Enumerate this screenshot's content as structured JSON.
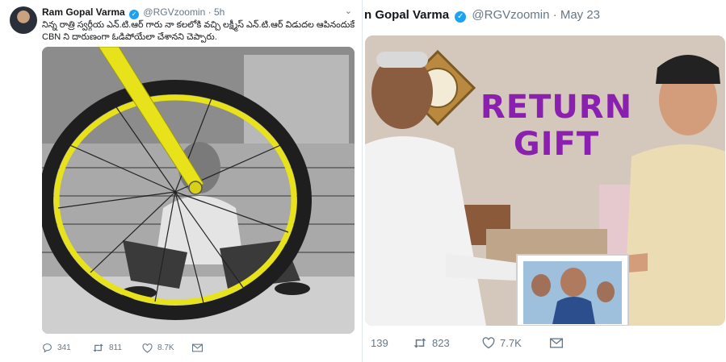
{
  "left_tweet": {
    "display_name": "Ram Gopal Varma",
    "handle": "@RGVzoomin",
    "time": "5h",
    "text": "నిన్న రాత్రి స్వర్గీయ ఎన్.టి.ఆర్ గారు నా కలలోకి వచ్చి లక్ష్మీస్ ఎన్.టి.ఆర్ విడుదల ఆపినందుకే CBN ని దారుణంగా ఓడిపోయేలా చేశానని చెప్పారు.",
    "replies": "341",
    "retweets": "811",
    "likes": "8.7K"
  },
  "right_tweet": {
    "display_name_partial": "n Gopal Varma",
    "handle": "@RGVzoomin",
    "date": "May 23",
    "image_caption": [
      "RETURN",
      "GIFT"
    ],
    "replies": "139",
    "retweets": "823",
    "likes": "7.7K"
  },
  "colors": {
    "verified": "#1da1f2",
    "meta_text": "#657786",
    "wheel_yellow": "#e8e21a",
    "caption_purple": "#8a1fb0"
  },
  "icons": {
    "reply": "reply-icon",
    "retweet": "retweet-icon",
    "like": "heart-icon",
    "dm": "envelope-icon",
    "menu": "chevron-down-icon"
  }
}
